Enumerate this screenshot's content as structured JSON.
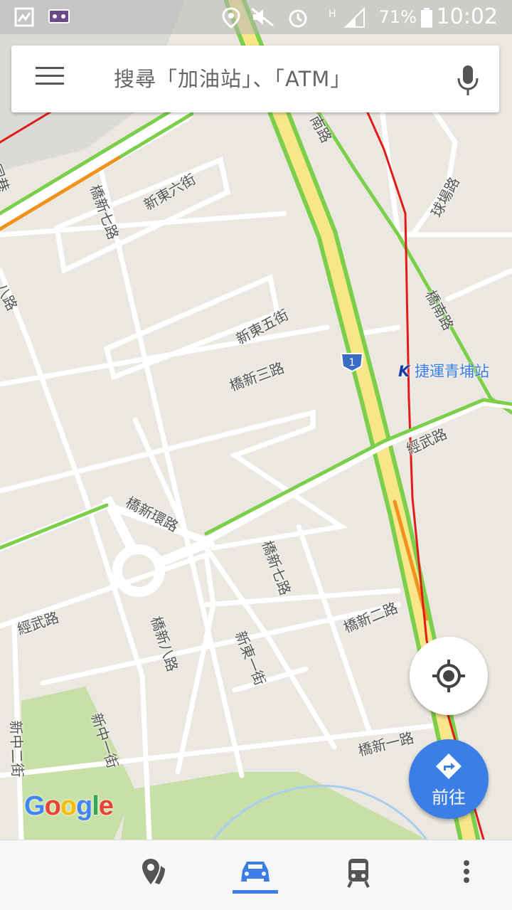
{
  "statusbar": {
    "battery_percent": "71%",
    "time": "10:02"
  },
  "search": {
    "placeholder": "搜尋「加油站」、「ATM」"
  },
  "map": {
    "labels": {
      "l1": "新東六街",
      "l2": "橋新七路",
      "l3": "新東五街",
      "l4": "橋新三路",
      "l5": "橋新環路",
      "l6": "橋新七路",
      "l7": "經武路",
      "l8": "經武路",
      "l9": "橋新八路",
      "l10": "新東一街",
      "l11": "橋新二路",
      "l12": "新中一街",
      "l13": "新中二街",
      "l14": "橋新一路",
      "l15": "橋南路",
      "l16": "球場路",
      "l17": "南路",
      "l18": "八路",
      "l19": "同巷"
    },
    "highway_shield": "1",
    "station": "捷運青埔站"
  },
  "logo": {
    "g1": "G",
    "o1": "o",
    "o2": "o",
    "g2": "g",
    "l": "l",
    "e": "e"
  },
  "buttons": {
    "go_label": "前往"
  },
  "colors": {
    "accent": "#3b7ee5",
    "traffic_green": "#7ccf4a",
    "traffic_orange": "#f2911b",
    "traffic_red": "#e11a1a",
    "highway_fill": "#f7e68a",
    "park": "#c8e0a8"
  }
}
